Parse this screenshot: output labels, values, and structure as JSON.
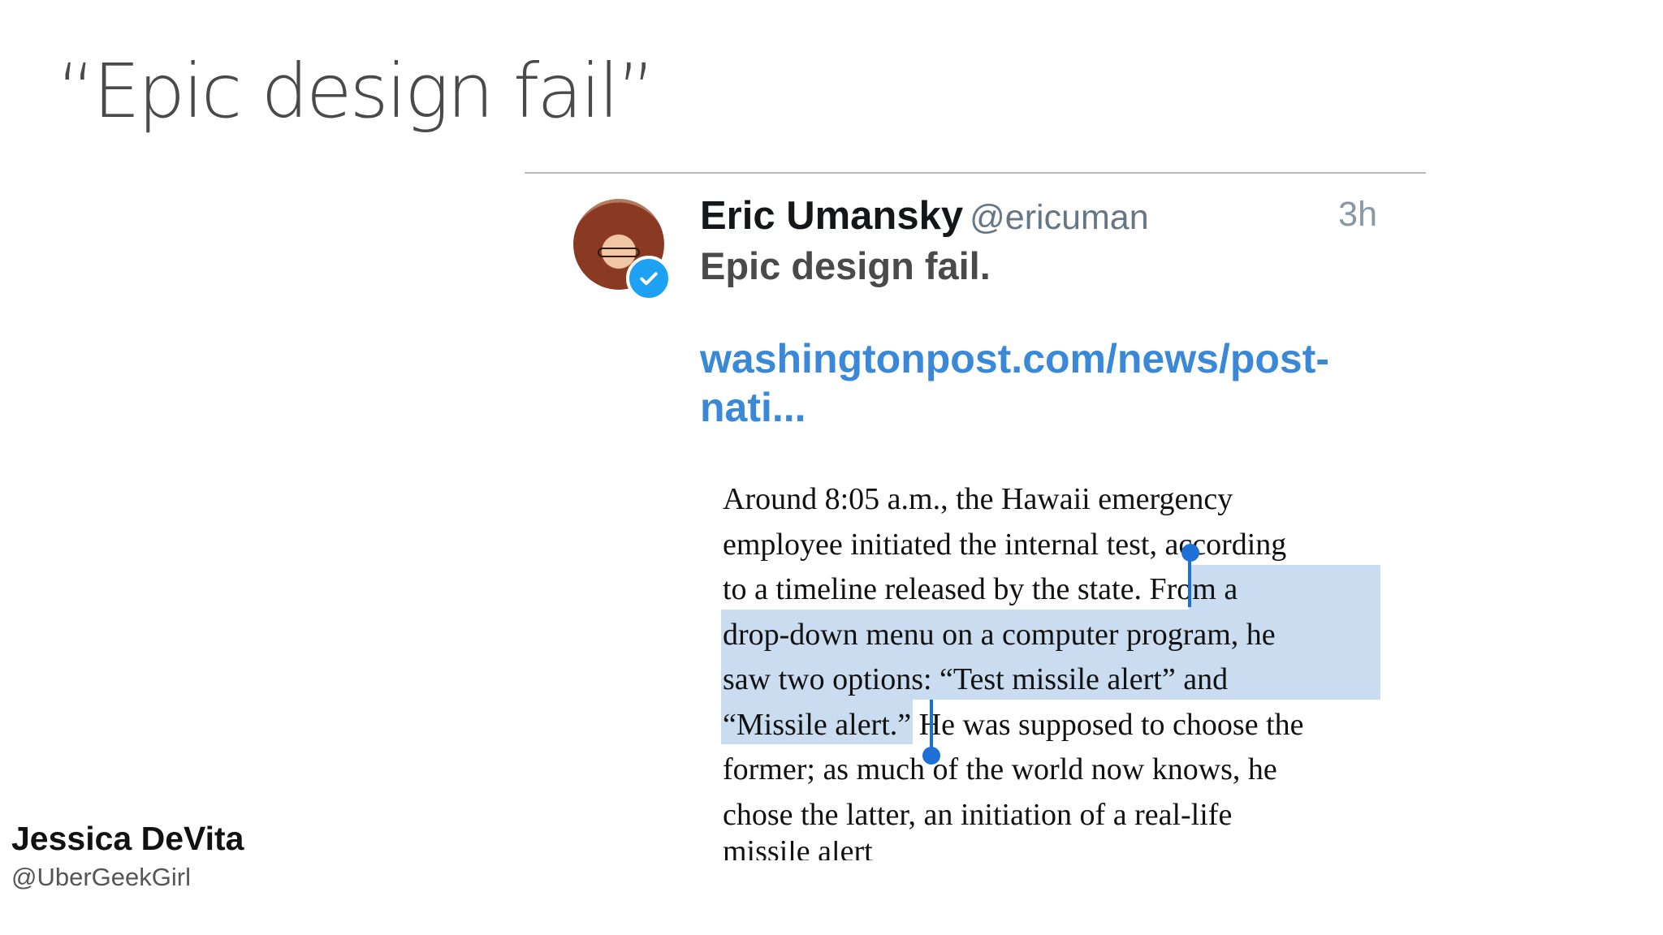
{
  "slide": {
    "title": "“Epic design fail”"
  },
  "tweet": {
    "author_name": "Eric Umansky",
    "author_handle": "@ericuman",
    "time": "3h",
    "text": "Epic design fail.",
    "link_lines": [
      "washingtonpost.com/news/post-",
      "nati..."
    ],
    "verified": true
  },
  "article": {
    "lines": [
      "Around 8:05 a.m., the Hawaii emergency",
      "employee initiated the internal test, according",
      "to a timeline released by the state.",
      "From a",
      "drop-down menu on a computer program, he",
      "saw two options: “Test missile alert” and",
      "“Missile alert.”",
      "He was supposed to choose the",
      "former; as much of the world now knows, he",
      "chose the latter, an initiation of a real-life",
      "missile alert"
    ],
    "selection": "From a drop-down menu on a computer program, he saw two options: “Test missile alert” and “Missile alert.”"
  },
  "credit": {
    "name": "Jessica DeVita",
    "handle": "@UberGeekGirl"
  },
  "colors": {
    "link": "#3a89d8",
    "selection": "#cadcef",
    "cursor": "#1e6fd8",
    "verified": "#1da1f2"
  },
  "icons": {
    "verified": "verified-badge-icon"
  }
}
